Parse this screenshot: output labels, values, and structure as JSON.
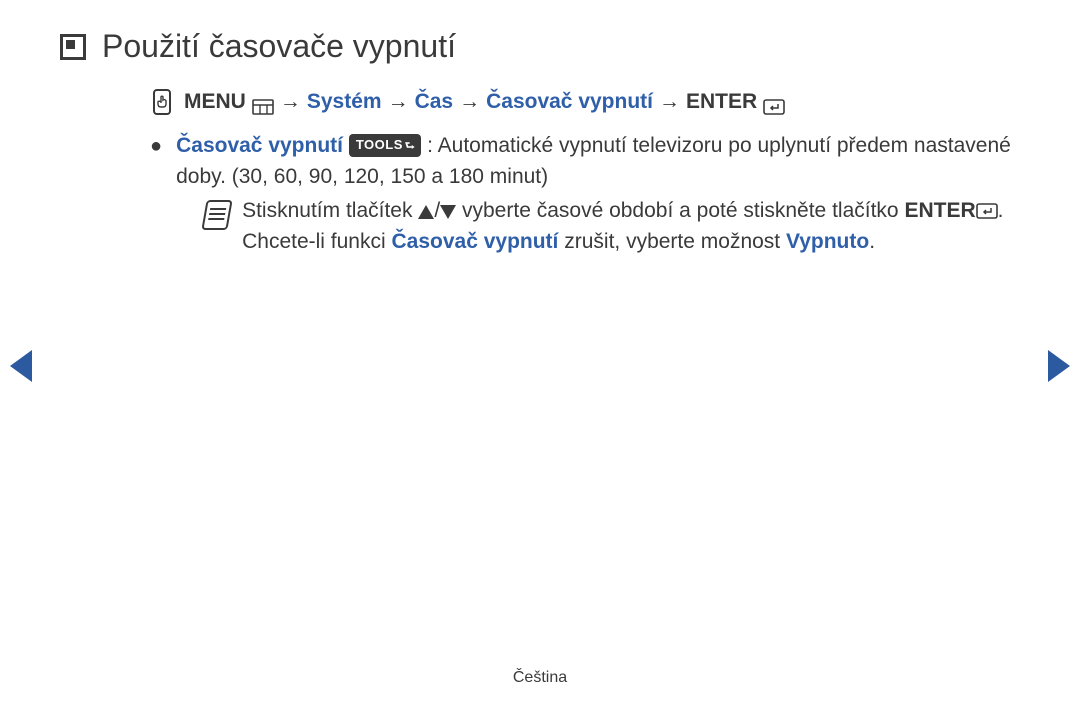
{
  "title": "Použití časovače vypnutí",
  "nav": {
    "menu_label": "MENU",
    "arrow": "→",
    "items": [
      "Systém",
      "Čas",
      "Časovač vypnutí"
    ],
    "enter_label": "ENTER"
  },
  "bulletItem": {
    "label": "Časovač vypnutí",
    "tools_badge": "TOOLS",
    "desc_part1": ": Automatické vypnutí televizoru po uplynutí předem nastavené doby. (30, 60, 90, 120, 150 a 180 minut)"
  },
  "note": {
    "line1a": "Stisknutím tlačítek ",
    "line1b": " vyberte časové období a poté stiskněte tlačítko ",
    "enter_label": "ENTER",
    "line2a": ". Chcete-li funkci ",
    "term": "Časovač vypnutí",
    "line2b": " zrušit, vyberte možnost ",
    "off": "Vypnuto",
    "period": "."
  },
  "footer": "Čeština"
}
